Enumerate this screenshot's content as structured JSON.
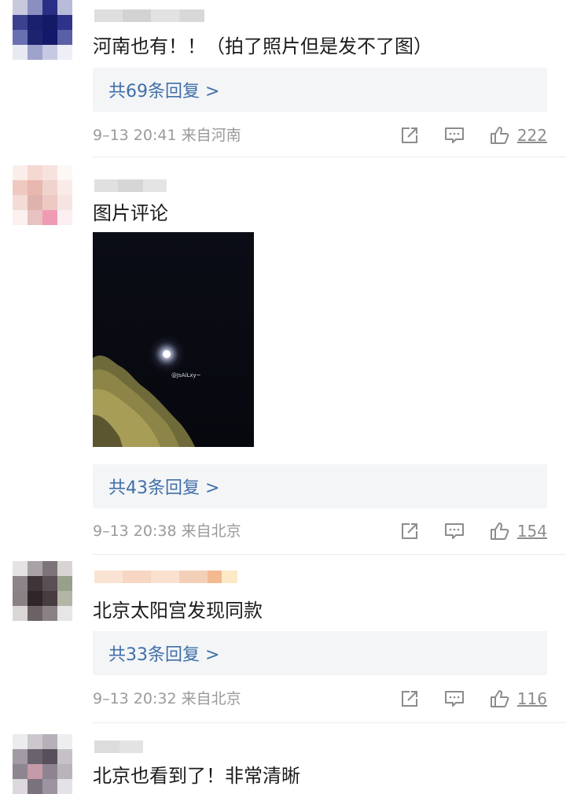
{
  "comments": [
    {
      "text": "河南也有！！（拍了照片但是发不了图）",
      "replies": "共69条回复 >",
      "time": "9–13 20:41 来自河南",
      "likes": "222"
    },
    {
      "text": "图片评论",
      "watermark": "@JsAiLxy~",
      "replies": "共43条回复 >",
      "time": "9–13 20:38 来自北京",
      "likes": "154"
    },
    {
      "text": "北京太阳宫发现同款",
      "replies": "共33条回复 >",
      "time": "9–13 20:32 来自北京",
      "likes": "116"
    },
    {
      "text": "北京也看到了！非常清晰"
    }
  ],
  "icons": {
    "share": "share-icon",
    "reply": "comment-icon",
    "like": "thumbs-up-icon"
  },
  "colors": {
    "reply_link": "#3f6fa8",
    "reply_bg": "#f4f5f7",
    "meta_text": "#9a9a9a"
  }
}
